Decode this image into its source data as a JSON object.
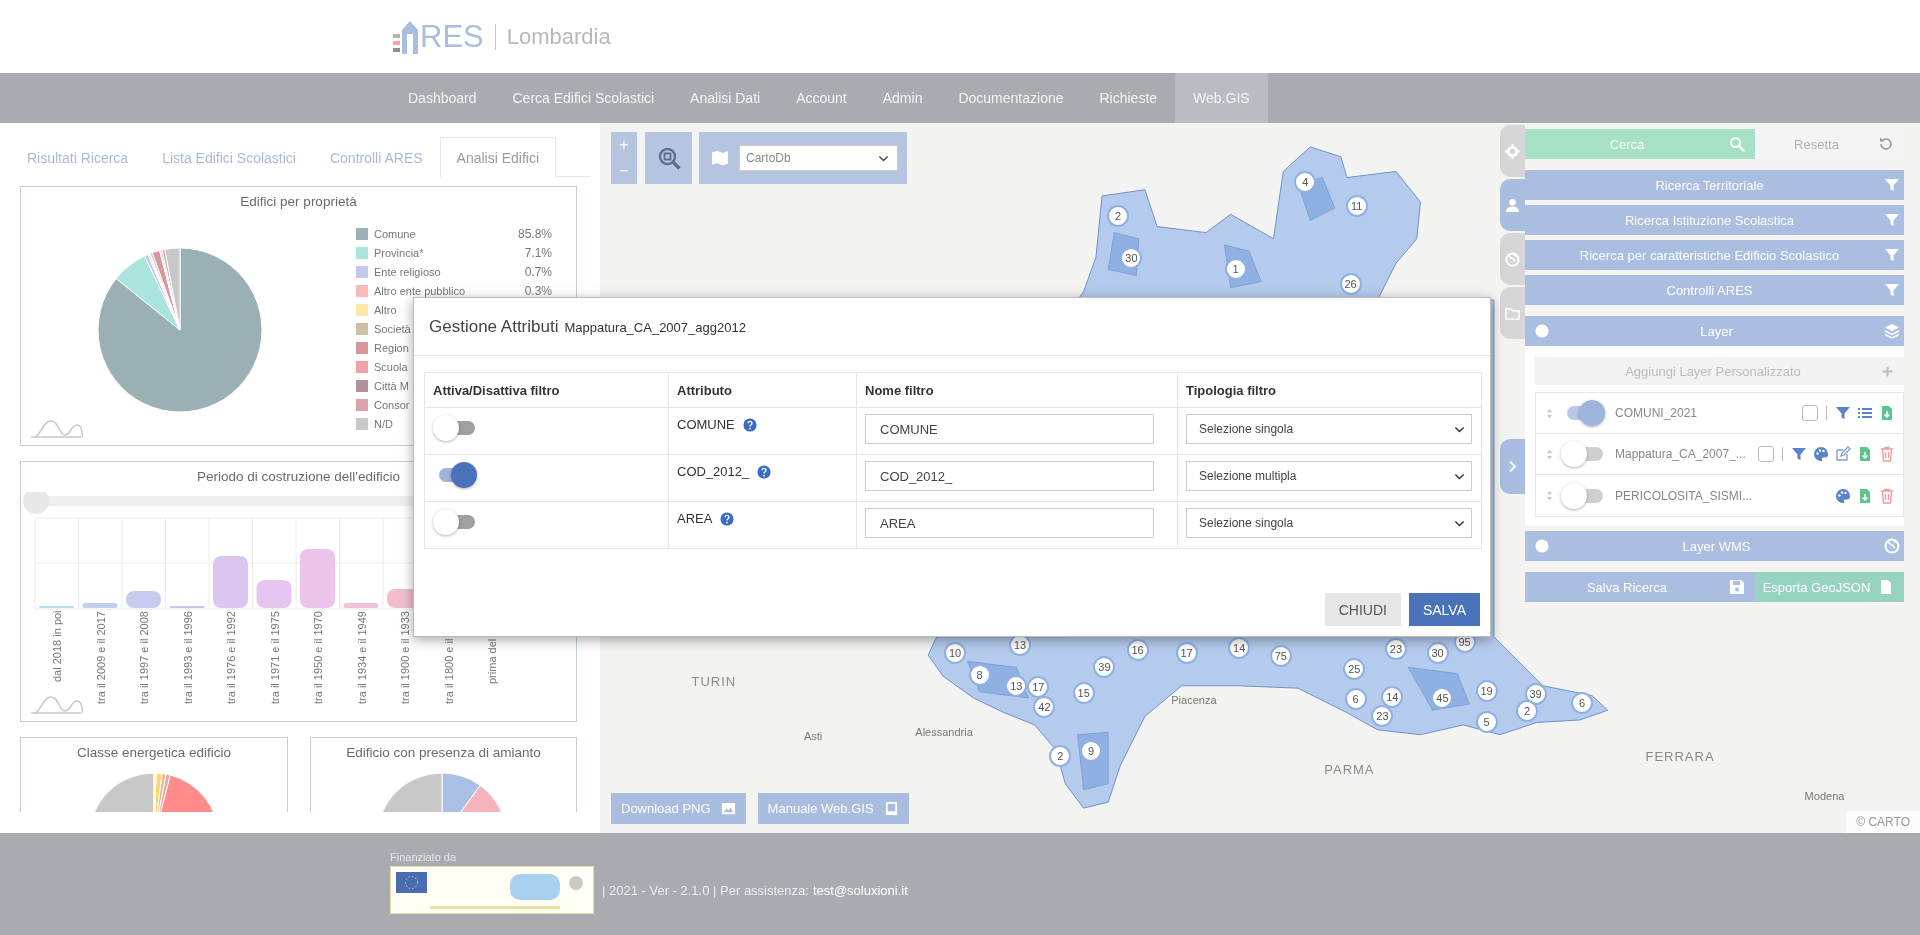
{
  "header": {
    "logo_text": "RES",
    "region": "Lombardia"
  },
  "nav": [
    {
      "label": "Dashboard",
      "selected": false
    },
    {
      "label": "Cerca Edifici Scolastici",
      "selected": false
    },
    {
      "label": "Analisi Dati",
      "selected": false
    },
    {
      "label": "Account",
      "selected": false
    },
    {
      "label": "Admin",
      "selected": false
    },
    {
      "label": "Documentazione",
      "selected": false
    },
    {
      "label": "Richieste",
      "selected": false
    },
    {
      "label": "Web.GIS",
      "selected": true
    }
  ],
  "left_panel": {
    "tabs": [
      {
        "label": "Risultati Ricerca",
        "selected": false
      },
      {
        "label": "Lista Edifici Scolastici",
        "selected": false
      },
      {
        "label": "Controlli ARES",
        "selected": false
      },
      {
        "label": "Analisi Edifici",
        "selected": true
      }
    ],
    "ownership_card": {
      "title": "Edifici per proprietà",
      "legend": [
        {
          "label": "Comune",
          "value": "85.8%",
          "color": "#9ab0b5"
        },
        {
          "label": "Provincia*",
          "value": "7.1%",
          "color": "#a9e4df"
        },
        {
          "label": "Ente religioso",
          "value": "0.7%",
          "color": "#c3c8e8"
        },
        {
          "label": "Altro ente pubblico",
          "value": "0.3%",
          "color": "#f8b9b9"
        },
        {
          "label": "Altro",
          "color": "#fbe7a8"
        },
        {
          "label": "Società",
          "color": "#cbbfa8"
        },
        {
          "label": "Region",
          "color": "#d9969d"
        },
        {
          "label": "Scuola",
          "color": "#f1a1ab"
        },
        {
          "label": "Città M",
          "color": "#b2919d"
        },
        {
          "label": "Consor",
          "color": "#d9a3a9"
        },
        {
          "label": "N/D",
          "color": "#c8c8c8"
        }
      ]
    },
    "period_card": {
      "title": "Periodo di costruzione dell'edificio",
      "categories": [
        "dal 2018 in poi",
        "tra il 2009 e il 2017",
        "tra il 1997 e il 2008",
        "tra il 1993 e il 1996",
        "tra il 1976 e il 1992",
        "tra il 1971 e il 1975",
        "tra il 1950 e il 1970",
        "tra il 1934 e il 1949",
        "tra il 1900 e il 1933",
        "tra il 1800 e il",
        "prima del"
      ]
    },
    "energy_card": {
      "title": "Classe energetica edificio"
    },
    "asbestos_card": {
      "title": "Edificio con presenza di amianto"
    }
  },
  "map": {
    "zoom_in": "+",
    "zoom_out": "−",
    "basemap": "CartoDb",
    "city_labels": [
      "TURIN",
      "Asti",
      "Alessandria",
      "Piacenza",
      "PARMA",
      "FERRARA",
      "Modena"
    ],
    "cluster_markers": [
      "4",
      "11",
      "2",
      "30",
      "1",
      "26",
      "10",
      "13",
      "16",
      "39",
      "17",
      "14",
      "75",
      "23",
      "30",
      "95",
      "25",
      "8",
      "13",
      "17",
      "42",
      "15",
      "6",
      "14",
      "23",
      "45",
      "19",
      "5",
      "39",
      "2",
      "6",
      "2",
      "9"
    ],
    "download_button": "Download PNG",
    "manual_button": "Manuale Web.GIS",
    "attribution": "© CARTO"
  },
  "side_tabs": [
    {
      "kind": "settings",
      "selected": false
    },
    {
      "kind": "user",
      "selected": true
    },
    {
      "kind": "globe",
      "selected": false
    },
    {
      "kind": "folder",
      "selected": false
    }
  ],
  "search_panel": {
    "search_button": "Cerca",
    "reset_button": "Resetta",
    "sections": [
      "Ricerca Territoriale",
      "Ricerca Istituzione Scolastica",
      "Ricerca per caratteristiche Edificio Scolastico",
      "Controlli ARES"
    ],
    "layer_header": "Layer",
    "add_layer": "Aggiungi Layer Personalizzato",
    "layers": [
      {
        "name": "COMUNI_2021",
        "on": true,
        "checked": false,
        "actions": [
          {
            "kind": "filter"
          },
          {
            "kind": "list"
          },
          {
            "kind": "download"
          }
        ]
      },
      {
        "name": "Mappatura_CA_2007_...",
        "on": false,
        "checked": false,
        "actions": [
          {
            "kind": "filter"
          },
          {
            "kind": "palette"
          },
          {
            "kind": "edit"
          },
          {
            "kind": "download"
          },
          {
            "kind": "trash"
          }
        ]
      },
      {
        "name": "PERICOLOSITA_SISMI...",
        "on": false,
        "actions": [
          {
            "kind": "palette"
          },
          {
            "kind": "download"
          },
          {
            "kind": "trash"
          }
        ]
      }
    ],
    "wms_header": "Layer WMS",
    "save_button": "Salva Ricerca",
    "export_button": "Esporta GeoJSON"
  },
  "modal": {
    "title": "Gestione Attributi",
    "layer": "Mappatura_CA_2007_agg2012",
    "columns": [
      "Attiva/Disattiva filtro",
      "Attributo",
      "Nome filtro",
      "Tipologia filtro"
    ],
    "rows": [
      {
        "on": false,
        "attribute": "COMUNE",
        "filter_name": "COMUNE",
        "filter_type": "Selezione singola"
      },
      {
        "on": true,
        "attribute": "COD_2012_",
        "filter_name": "COD_2012_",
        "filter_type": "Selezione multipla"
      },
      {
        "on": false,
        "attribute": "AREA",
        "filter_name": "AREA",
        "filter_type": "Selezione singola"
      }
    ],
    "buttons": [
      {
        "label": "CHIUDI",
        "kind": "secondary"
      },
      {
        "label": "SALVA",
        "kind": "primary"
      }
    ]
  },
  "footer": {
    "funded_by": "Finanziato da",
    "version": "| 2021 - Ver - 2.1.0 | Per assistenza:",
    "email": "test@soluxioni.it"
  }
}
